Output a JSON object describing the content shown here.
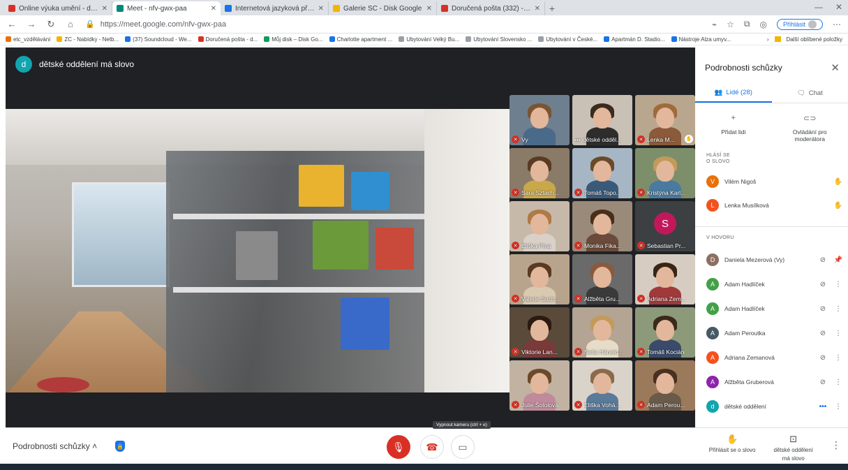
{
  "browser": {
    "tabs": [
      {
        "title": "Online výuka umění - dmsearc",
        "color": "#d93025",
        "active": false
      },
      {
        "title": "Meet - nfv-gwx-paa",
        "color": "#00897b",
        "active": true
      },
      {
        "title": "Internetová jazyková příručka",
        "color": "#1a73e8",
        "active": false
      },
      {
        "title": "Galerie SC - Disk Google",
        "color": "#f4b400",
        "active": false
      },
      {
        "title": "Doručená pošta (332) - dmsearc",
        "color": "#d93025",
        "active": false
      }
    ],
    "new_tab": "+",
    "url": "https://meet.google.com/nfv-gwx-paa",
    "signin_label": "Přihlásit",
    "bookmarks": [
      "etc_vzdělávání",
      "ZC - Nabídky - Netb...",
      "(37) Soundcloud - We...",
      "Doručená pošta - d...",
      "Můj disk – Disk Go...",
      "Charlotte apartment ...",
      "Ubytování Velký Bu...",
      "Ubytování Slovensko ...",
      "Ubytování v České...",
      "Apartmán D. Stadio...",
      "Nástroje Alza umyv..."
    ],
    "other_bookmarks": "Další oblíbené položky"
  },
  "meeting": {
    "owner_initial": "d",
    "title": "dětské oddělení má slovo"
  },
  "tiles": [
    {
      "name": "Vy",
      "type": "video",
      "bg": "#6e7f8f",
      "hair": "#7a5532",
      "body": "#4a6a8a",
      "muted": true
    },
    {
      "name": "dětské odděl...",
      "type": "video",
      "bg": "#c9c0b6",
      "hair": "#3b2a1e",
      "body": "#2d2d2d",
      "muted": false,
      "dots": "•••"
    },
    {
      "name": "Lenka M...",
      "type": "video",
      "bg": "#b9a68e",
      "hair": "#a06a3a",
      "body": "#8a5a3a",
      "muted": true,
      "pin": true
    },
    {
      "name": "Sara Sztach...",
      "type": "video",
      "bg": "#8a7a68",
      "hair": "#5a3a22",
      "body": "#c9a84a",
      "muted": true
    },
    {
      "name": "Tomáš Topo...",
      "type": "video",
      "bg": "#a7b6c4",
      "hair": "#6b4a2a",
      "body": "#3a5a7a",
      "muted": true
    },
    {
      "name": "Kristýna Karl...",
      "type": "video",
      "bg": "#7c8f6a",
      "hair": "#c49a5a",
      "body": "#4a7aa0",
      "muted": true
    },
    {
      "name": "Eliška Pína",
      "type": "video",
      "bg": "#c7b9a9",
      "hair": "#b07a45",
      "body": "#d9d1c8",
      "muted": true
    },
    {
      "name": "Monika Fika...",
      "type": "video",
      "bg": "#9a8a7a",
      "hair": "#4a2e1a",
      "body": "#6a4a3a",
      "muted": true
    },
    {
      "name": "Sebastian Pr...",
      "type": "initial",
      "initial": "S",
      "muted": true
    },
    {
      "name": "Valerie Such...",
      "type": "video",
      "bg": "#b8a48c",
      "hair": "#5a3a22",
      "body": "#d9c9b0",
      "muted": true
    },
    {
      "name": "Alžběta Gru...",
      "type": "video",
      "bg": "#6a6a6a",
      "hair": "#8a5a3a",
      "body": "#3a3a3a",
      "muted": true
    },
    {
      "name": "Adriana Zem...",
      "type": "video",
      "bg": "#d6ccc2",
      "hair": "#3a2414",
      "body": "#a03a3a",
      "muted": true
    },
    {
      "name": "Viktorie Lan...",
      "type": "video",
      "bg": "#5a4a3a",
      "hair": "#2a1a10",
      "body": "#7a3a3a",
      "muted": true
    },
    {
      "name": "Nella Hánelo...",
      "type": "video",
      "bg": "#b4a493",
      "hair": "#c49a5a",
      "body": "#e6dcc8",
      "muted": true
    },
    {
      "name": "Tomáš Kocián",
      "type": "video",
      "bg": "#8c9a7a",
      "hair": "#3a2a1a",
      "body": "#3a4a6a",
      "muted": true
    },
    {
      "name": "Julie Šotolová",
      "type": "video",
      "bg": "#c2b2a2",
      "hair": "#6a4a2a",
      "body": "#c08a9a",
      "muted": true
    },
    {
      "name": "Eliška Vohá...",
      "type": "video",
      "bg": "#dad3ca",
      "hair": "#8a6a4a",
      "body": "#5a7a9a",
      "muted": true
    },
    {
      "name": "Adam Perou...",
      "type": "video",
      "bg": "#9a7a5a",
      "hair": "#4a3020",
      "body": "#6a5a4a",
      "muted": true
    }
  ],
  "panel": {
    "title": "Podrobnosti schůzky",
    "tab_people": "Lidé (28)",
    "tab_chat": "Chat",
    "action_add": "Přidat lidi",
    "action_host": "Ovládání pro moderátora",
    "section_raised_1": "HLÁSÍ SE",
    "section_raised_2": "O SLOVO",
    "raised": [
      {
        "initial": "V",
        "name": "Vilém Nigoš",
        "color": "#e8710a"
      },
      {
        "initial": "L",
        "name": "Lenka Musílková",
        "color": "#f4511e"
      }
    ],
    "section_call": "V HOVORU",
    "in_call": [
      {
        "initial": "D",
        "name": "Daniela Mezerová (Vy)",
        "color": "#8d6e63",
        "icon2": "📌"
      },
      {
        "initial": "A",
        "name": "Adam Hadlíček",
        "color": "#43a047",
        "icon2": "⋮"
      },
      {
        "initial": "A",
        "name": "Adam Hadlíček",
        "color": "#43a047",
        "icon2": "⋮"
      },
      {
        "initial": "A",
        "name": "Adam Peroutka",
        "color": "#455a64",
        "icon2": "⋮"
      },
      {
        "initial": "A",
        "name": "Adriana Zemanová",
        "color": "#f4511e",
        "icon2": "⋮"
      },
      {
        "initial": "A",
        "name": "Alžběta Gruberová",
        "color": "#8e24aa",
        "icon2": "⋮"
      },
      {
        "initial": "d",
        "name": "dětské oddělení",
        "color": "#12a4af",
        "icon2": "⋮",
        "speaking": true
      }
    ]
  },
  "bottom": {
    "details_label": "Podrobnosti schůzky",
    "tooltip": "Vypnout kameru (ctrl + e)",
    "raise_hand": "Přihlásit se o slovo",
    "presenter_1": "dětské oddělení",
    "presenter_2": "má slovo"
  }
}
